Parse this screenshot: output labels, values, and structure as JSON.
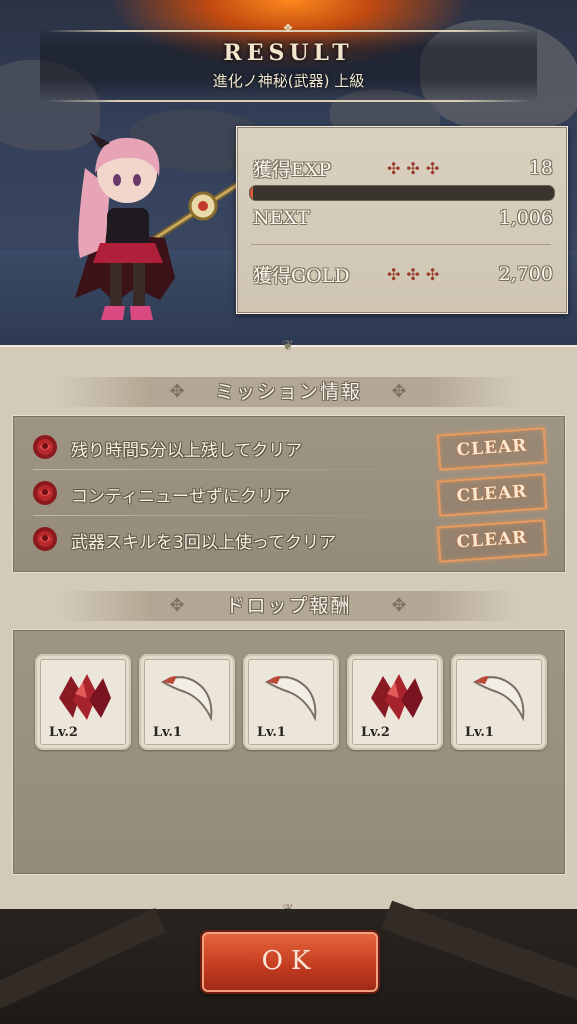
{
  "header": {
    "title": "RESULT",
    "subtitle": "進化ノ神秘(武器) 上級"
  },
  "stats": {
    "exp_label": "獲得EXP",
    "exp_value": "18",
    "exp_bar_fraction": 0.01,
    "next_label": "NEXT",
    "next_value": "1,006",
    "gold_label": "獲得GOLD",
    "gold_value": "2,700",
    "crosses": "✣✣✣"
  },
  "missions": {
    "heading": "ミッション情報",
    "items": [
      {
        "text": "残り時間5分以上残してクリア",
        "status": "CLEAR"
      },
      {
        "text": "コンティニューせずにクリア",
        "status": "CLEAR"
      },
      {
        "text": "武器スキルを3回以上使ってクリア",
        "status": "CLEAR"
      }
    ]
  },
  "drops": {
    "heading": "ドロップ報酬",
    "items": [
      {
        "icon": "red-crystal-icon",
        "level": "Lv.2"
      },
      {
        "icon": "claw-fang-icon",
        "level": "Lv.1"
      },
      {
        "icon": "claw-fang-icon",
        "level": "Lv.1"
      },
      {
        "icon": "red-crystal-icon",
        "level": "Lv.2"
      },
      {
        "icon": "claw-fang-icon",
        "level": "Lv.1"
      }
    ]
  },
  "ok_label": "OK",
  "colors": {
    "accent_red": "#c53e22",
    "panel_bg": "#d3cab8",
    "clear_stamp": "#e89b5e"
  }
}
